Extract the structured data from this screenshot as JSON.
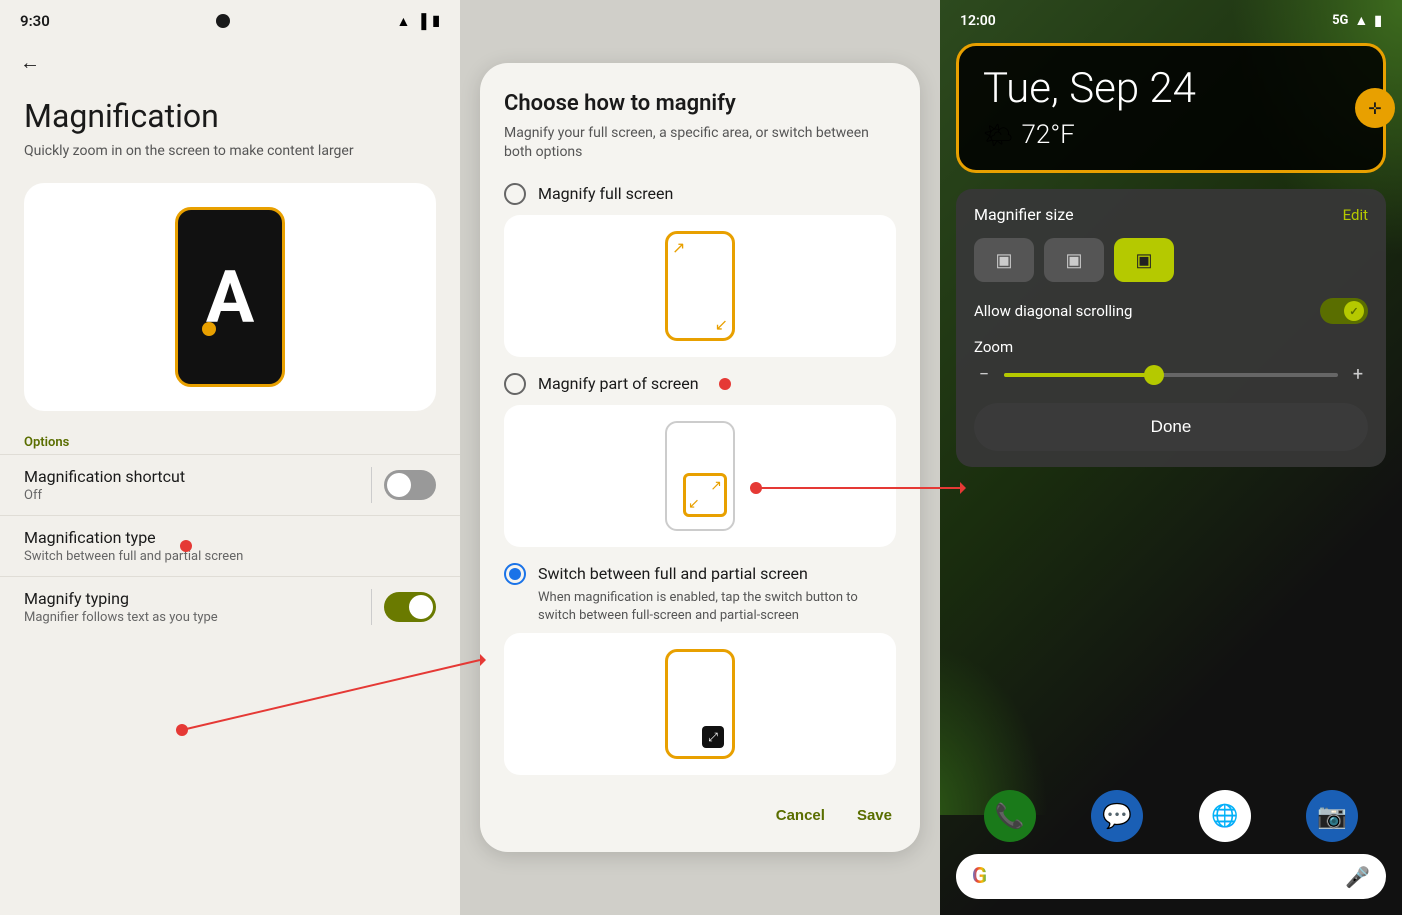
{
  "panel1": {
    "status_time": "9:30",
    "title": "Magnification",
    "subtitle": "Quickly zoom in on the screen to make content larger",
    "options_label": "Options",
    "settings": [
      {
        "title": "Magnification shortcut",
        "desc": "Off",
        "toggle": "off",
        "has_toggle": true
      },
      {
        "title": "Magnification type",
        "desc": "Switch between full and partial screen",
        "toggle": null,
        "has_toggle": false
      },
      {
        "title": "Magnify typing",
        "desc": "Magnifier follows text as you type",
        "toggle": "on",
        "has_toggle": true
      }
    ],
    "back_label": "←"
  },
  "panel2": {
    "title": "Choose how to magnify",
    "desc": "Magnify your full screen, a specific area, or switch between both options",
    "options": [
      {
        "label": "Magnify full screen",
        "selected": false
      },
      {
        "label": "Magnify part of screen",
        "selected": false
      },
      {
        "label": "Switch between full and partial screen",
        "selected": true,
        "sub_desc": "When magnification is enabled, tap the switch button to switch between full-screen and partial-screen"
      }
    ],
    "cancel_label": "Cancel",
    "save_label": "Save"
  },
  "panel3": {
    "status_time": "12:00",
    "signal": "5G",
    "clock_date": "Tue, Sep 24",
    "weather_temp": "72°F",
    "magnifier": {
      "title": "Magnifier size",
      "edit_label": "Edit",
      "sizes": [
        "small",
        "medium",
        "large"
      ],
      "active_size": 2,
      "diagonal_label": "Allow diagonal scrolling",
      "diagonal_on": true,
      "zoom_label": "Zoom",
      "done_label": "Done"
    },
    "apps": [
      "📞",
      "💬",
      "⬤",
      "📷"
    ]
  },
  "icons": {
    "back": "←",
    "move": "✛",
    "check": "✓",
    "minus": "−",
    "plus": "+"
  }
}
